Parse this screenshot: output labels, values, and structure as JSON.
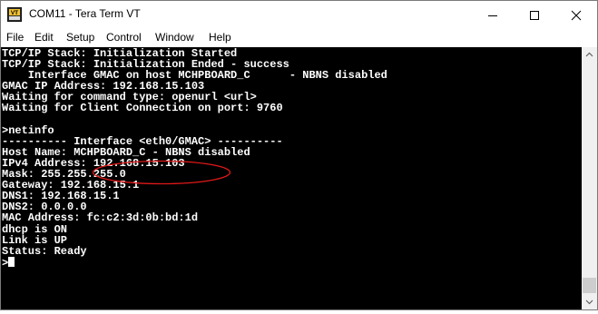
{
  "window": {
    "title": "COM11 - Tera Term VT"
  },
  "menu": {
    "items": [
      "File",
      "Edit",
      "Setup",
      "Control",
      "Window",
      "Help"
    ]
  },
  "terminal": {
    "lines": [
      "TCP/IP Stack: Initialization Started",
      "TCP/IP Stack: Initialization Ended - success",
      "    Interface GMAC on host MCHPBOARD_C      - NBNS disabled",
      "GMAC IP Address: 192.168.15.103",
      "Waiting for command type: openurl <url>",
      "Waiting for Client Connection on port: 9760",
      "",
      ">netinfo",
      "---------- Interface <eth0/GMAC> ----------",
      "Host Name: MCHPBOARD_C - NBNS disabled",
      "IPv4 Address: 192.168.15.103",
      "Mask: 255.255.255.0",
      "Gateway: 192.168.15.1",
      "DNS1: 192.168.15.1",
      "DNS2: 0.0.0.0",
      "MAC Address: fc:c2:3d:0b:bd:1d",
      "dhcp is ON",
      "Link is UP",
      "Status: Ready",
      ">"
    ]
  },
  "icons": {
    "app": "teraterm-vt-icon",
    "minimize": "minimize-icon",
    "maximize": "maximize-icon",
    "close": "close-icon",
    "annotation": "red-ellipse-annotation"
  },
  "colors": {
    "terminal_bg": "#000000",
    "terminal_fg": "#ffffff",
    "annotation": "#e01818",
    "app_icon_accent": "#f2c230"
  }
}
